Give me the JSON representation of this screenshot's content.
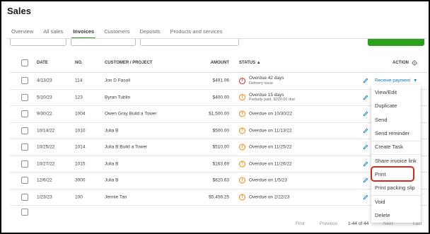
{
  "page": {
    "title": "Sales"
  },
  "tabs": [
    {
      "label": "Overview"
    },
    {
      "label": "All sales"
    },
    {
      "label": "Invoices",
      "active": true
    },
    {
      "label": "Customers"
    },
    {
      "label": "Deposits"
    },
    {
      "label": "Products and services"
    }
  ],
  "table": {
    "headers": {
      "date": "DATE",
      "no": "NO.",
      "customer": "CUSTOMER / PROJECT",
      "amount": "AMOUNT",
      "status": "STATUS ▲",
      "action": "ACTION"
    },
    "rows": [
      {
        "date": "4/13/23",
        "no": "114",
        "customer": "Jon D Fasoli",
        "amount": "$491.06",
        "status": "Overdue 42 days",
        "status_sub": "Delivery issue",
        "severity": "red",
        "action": "Receive payment"
      },
      {
        "date": "5/10/23",
        "no": "123",
        "customer": "Byran Tublin",
        "amount": "$400.00",
        "status": "Overdue 15 days",
        "status_sub": "Partially paid, $200.00 due",
        "severity": "orange"
      },
      {
        "date": "9/30/22",
        "no": "1004",
        "customer": "Owen Gray Build a Tower",
        "amount": "$1,500.00",
        "status": "Overdue on 10/30/22",
        "status_sub": "",
        "severity": "orange"
      },
      {
        "date": "10/14/22",
        "no": "1010",
        "customer": "Julia B",
        "amount": "$500.00",
        "status": "Overdue on 11/13/22",
        "status_sub": "",
        "severity": "orange"
      },
      {
        "date": "10/25/22",
        "no": "1014",
        "customer": "Julia B:Build a Tower",
        "amount": "$510.00",
        "status": "Overdue on 11/25/22",
        "status_sub": "",
        "severity": "orange"
      },
      {
        "date": "10/27/22",
        "no": "1015",
        "customer": "Julia B",
        "amount": "$163.69",
        "status": "Overdue on 11/26/22",
        "status_sub": "",
        "severity": "orange"
      },
      {
        "date": "12/6/22",
        "no": "3000",
        "customer": "Julia B",
        "amount": "$820.63",
        "status": "Overdue on 1/5/23",
        "status_sub": "",
        "severity": "orange"
      },
      {
        "date": "1/23/23",
        "no": "100",
        "customer": "Jennie Tan",
        "amount": "$5,456.25",
        "status": "Overdue on 2/22/23",
        "status_sub": "",
        "severity": "orange"
      }
    ]
  },
  "dropdown": {
    "items": [
      {
        "label": "View/Edit"
      },
      {
        "label": "Duplicate"
      },
      {
        "label": "Send"
      },
      {
        "label": "Send reminder"
      },
      {
        "label": "Create Task"
      },
      {
        "label": "Share invoice link"
      },
      {
        "label": "Print",
        "highlighted": true
      },
      {
        "label": "Print packing slip"
      },
      {
        "label": "Void"
      },
      {
        "label": "Delete"
      }
    ]
  },
  "pagination": {
    "first": "First",
    "previous": "Previous",
    "range": "1-44 of 44",
    "next": "Next",
    "last": "Last"
  },
  "colors": {
    "accent_green": "#2ca01c",
    "link_blue": "#0077c5",
    "danger_red": "#d52b1e",
    "warning_orange": "#ff8000"
  }
}
